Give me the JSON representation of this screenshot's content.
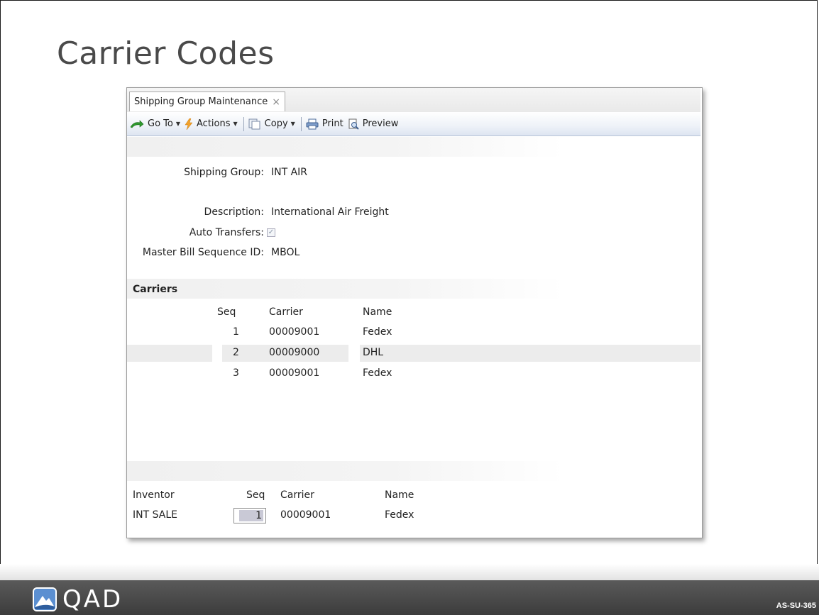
{
  "slide": {
    "title": "Carrier Codes",
    "doc_code": "AS-SU-365",
    "logo_text": "QAD"
  },
  "window": {
    "tab_label": "Shipping Group Maintenance",
    "tab_close": "×",
    "toolbar": {
      "goto": "Go To",
      "actions": "Actions",
      "copy": "Copy",
      "print": "Print",
      "preview": "Preview"
    }
  },
  "form": {
    "shipping_group_label": "Shipping Group:",
    "shipping_group_value": "INT AIR",
    "description_label": "Description:",
    "description_value": "International Air Freight",
    "auto_transfers_label": "Auto Transfers:",
    "auto_transfers_checked": true,
    "master_bill_label": "Master Bill Sequence ID:",
    "master_bill_value": "MBOL"
  },
  "carriers": {
    "section_title": "Carriers",
    "headers": {
      "seq": "Seq",
      "carrier": "Carrier",
      "name": "Name"
    },
    "rows": [
      {
        "seq": "1",
        "carrier": "00009001",
        "name": "Fedex"
      },
      {
        "seq": "2",
        "carrier": "00009000",
        "name": "DHL"
      },
      {
        "seq": "3",
        "carrier": "00009001",
        "name": "Fedex"
      }
    ],
    "highlighted_row": 2
  },
  "inventory": {
    "headers": {
      "inventor": "Inventor",
      "seq": "Seq",
      "carrier": "Carrier",
      "name": "Name"
    },
    "row": {
      "inventor": "INT SALE",
      "seq": "1",
      "carrier": "00009001",
      "name": "Fedex"
    }
  },
  "colors": {
    "footer": "#4a4a4a",
    "title": "#4a4a4a",
    "toolbar_accent": "#dde5f1"
  }
}
